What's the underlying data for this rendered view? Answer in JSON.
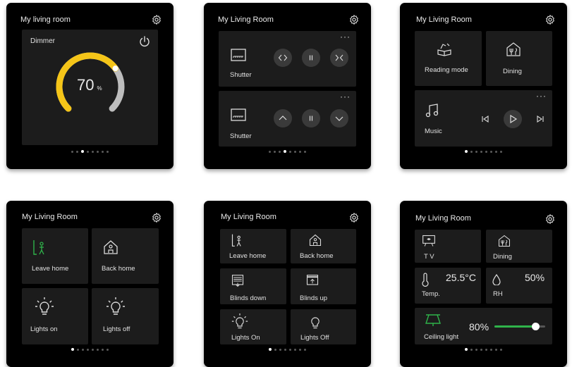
{
  "panel1": {
    "title": "My living room",
    "dimmer_label": "Dimmer",
    "value": "70",
    "unit": "%",
    "level_percent": 70
  },
  "panel2": {
    "title": "My Living Room",
    "shutter1_label": "Shutter",
    "shutter2_label": "Shutter",
    "ellipsis": "···"
  },
  "panel3": {
    "title": "My Living Room",
    "reading_label": "Reading mode",
    "dining_label": "Dining",
    "music_label": "Music",
    "ellipsis": "···"
  },
  "panel4": {
    "title": "My Living Room",
    "leave_label": "Leave home",
    "back_label": "Back home",
    "lights_on_label": "Lights on",
    "lights_off_label": "Lights off"
  },
  "panel5": {
    "title": "My Living Room",
    "leave_label": "Leave home",
    "back_label": "Back home",
    "blinds_down_label": "Blinds down",
    "blinds_up_label": "Blinds up",
    "lights_on_label": "Lights On",
    "lights_off_label": "Lights Off"
  },
  "panel6": {
    "title": "My Living Room",
    "tv_label": "T V",
    "dining_label": "Dining",
    "temp_value": "25.5°C",
    "temp_label": "Temp.",
    "rh_value": "50%",
    "rh_label": "RH",
    "ceiling_value": "80%",
    "ceiling_label": "Ceiling light",
    "ceiling_level_percent": 80
  },
  "colors": {
    "accent_yellow": "#f5c518",
    "accent_green": "#2fb34a",
    "tile_bg": "#1c1c1c",
    "panel_bg": "#000000"
  }
}
